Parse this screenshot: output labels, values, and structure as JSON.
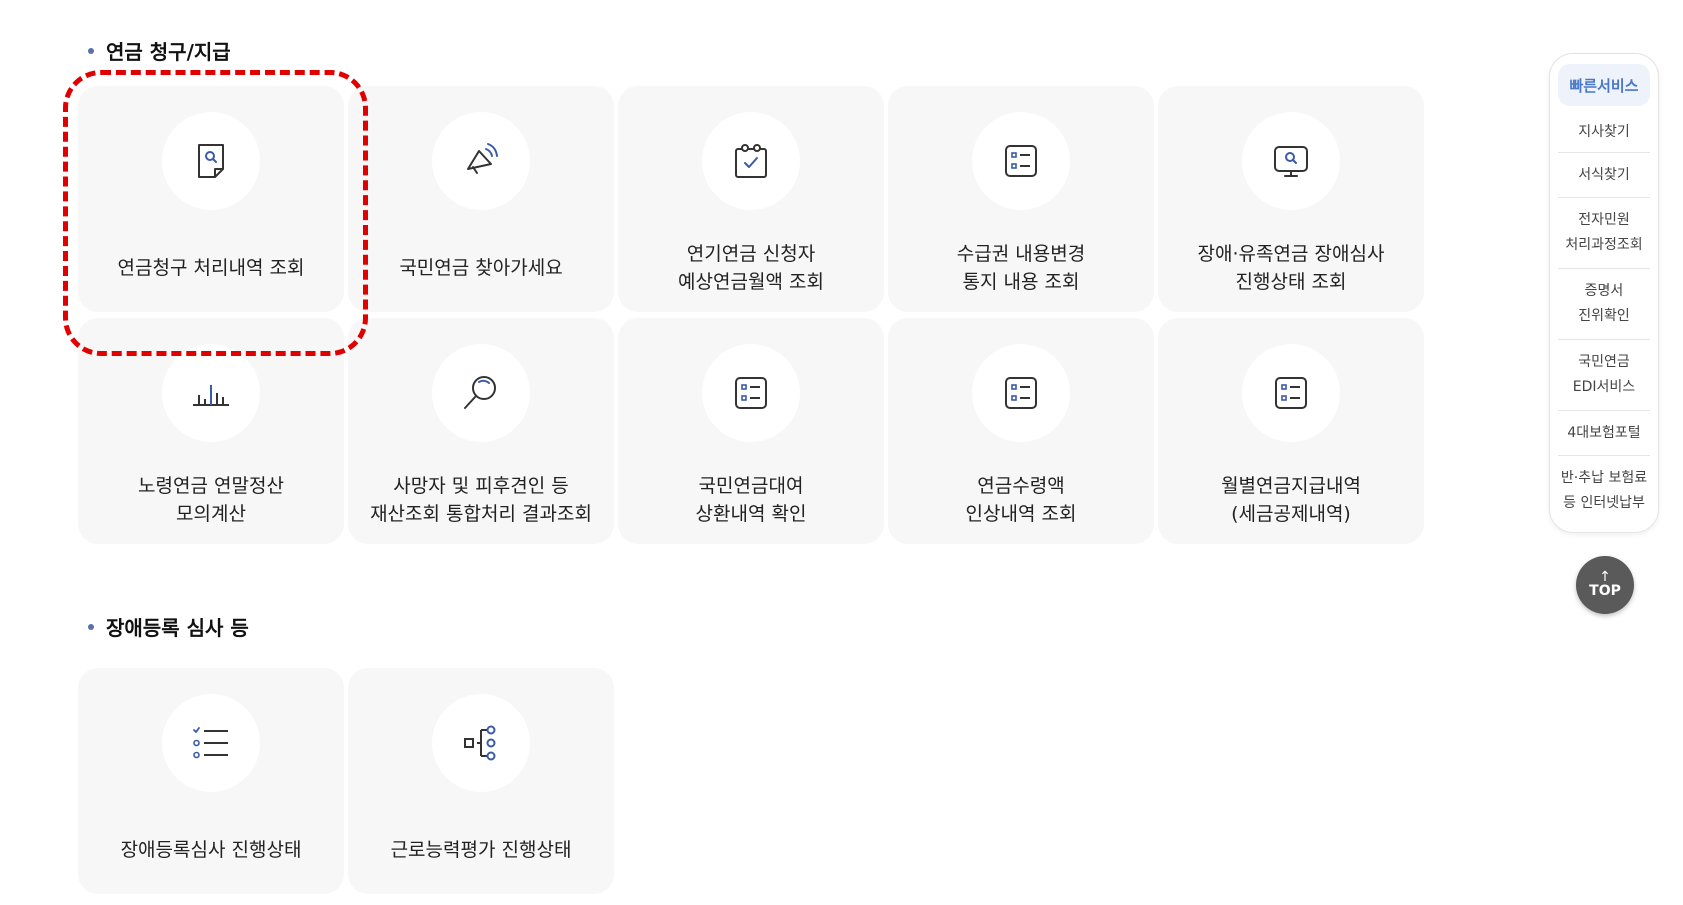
{
  "section1": {
    "title": "연금 청구/지급",
    "cards": [
      {
        "label": "연금청구 처리내역 조회",
        "icon": "document-search-icon"
      },
      {
        "label": "국민연금 찾아가세요",
        "icon": "megaphone-icon"
      },
      {
        "label": "연기연금 신청자\n예상연금월액 조회",
        "icon": "calendar-check-icon"
      },
      {
        "label": "수급권 내용변경\n통지 내용 조회",
        "icon": "list-box-icon"
      },
      {
        "label": "장애·유족연금 장애심사\n진행상태 조회",
        "icon": "monitor-search-icon"
      },
      {
        "label": "노령연금 연말정산\n모의계산",
        "icon": "bar-chart-icon"
      },
      {
        "label": "사망자 및 피후견인 등\n재산조회 통합처리 결과조회",
        "icon": "magnifier-icon"
      },
      {
        "label": "국민연금대여\n상환내역 확인",
        "icon": "list-box-icon"
      },
      {
        "label": "연금수령액\n인상내역 조회",
        "icon": "list-box-icon"
      },
      {
        "label": "월별연금지급내역\n(세금공제내역)",
        "icon": "list-box-icon"
      }
    ]
  },
  "section2": {
    "title": "장애등록 심사 등",
    "cards": [
      {
        "label": "장애등록심사 진행상태",
        "icon": "checklist-icon"
      },
      {
        "label": "근로능력평가 진행상태",
        "icon": "process-flow-icon"
      }
    ]
  },
  "quick_panel": {
    "title": "빠른서비스",
    "items": [
      "지사찾기",
      "서식찾기",
      "전자민원\n처리과정조회",
      "증명서\n진위확인",
      "국민연금\nEDI서비스",
      "4대보험포털",
      "반·추납 보험료\n등 인터넷납부"
    ]
  },
  "top_button": {
    "label": "TOP",
    "arrow": "↑"
  },
  "colors": {
    "highlight": "#e00000",
    "card_bg": "#f7f7f7",
    "accent_blue": "#4a78c8"
  }
}
